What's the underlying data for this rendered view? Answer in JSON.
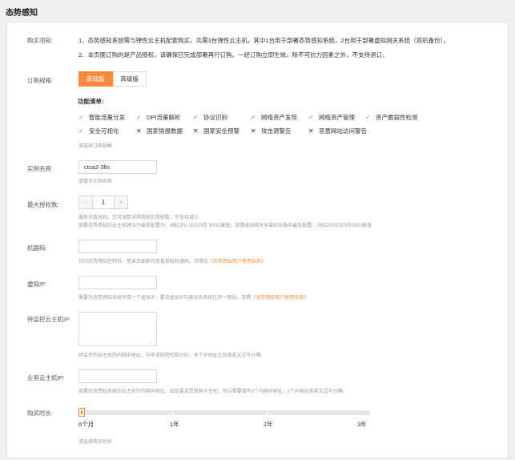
{
  "page": {
    "title": "态势感知"
  },
  "purchase_notice": {
    "label": "购买须知:",
    "lines": [
      "1、态势感知系统需与弹性云主机配套购买，共需3台弹性云主机，其中1台用于部署态势感知系统，2台用于部署虚拟网关系统（双机备份）。",
      "2、本页面订购的是产品授权，请确保已完成部署再行订购。一经订购立即生效，除不可抗力因素之外，不支持退订。"
    ]
  },
  "spec": {
    "label": "订购规格:",
    "tabs": [
      "基础版",
      "高级版"
    ],
    "active_tab": 0,
    "feature_title": "功能清单:",
    "features": [
      {
        "name": "智能流量分发",
        "included": true
      },
      {
        "name": "DPI流量解析",
        "included": true
      },
      {
        "name": "协议识别",
        "included": true
      },
      {
        "name": "网络资产发现",
        "included": true
      },
      {
        "name": "网络资产管理",
        "included": true
      },
      {
        "name": "资产脆弱性检测",
        "included": true
      },
      {
        "name": "安全可视化",
        "included": true
      },
      {
        "name": "国家情报数据",
        "included": false
      },
      {
        "name": "国家安全预警",
        "included": false
      },
      {
        "name": "攻击源警告",
        "included": false
      },
      {
        "name": "恶意网站访问警告",
        "included": false
      }
    ],
    "hint": "请选择订购规格",
    "colors": {
      "accent": "#ff8a3d",
      "check": "#52b152"
    }
  },
  "instance": {
    "label": "实例名称:",
    "value": "ctsa2-3fis",
    "hint": "请填写实例名称"
  },
  "max_auth": {
    "label": "最大授权数:",
    "value": "1",
    "minus": "−",
    "plus": "+",
    "hint1": "服务台数总和。您可调整采购授权的授权数，不支持减小",
    "hint2": "部署态势感知的云主机建议为最低配置为：4核CPU 32G内存 500G硬盘；部署虚拟网关安装的云服务最低配置：2核CPU/2G内存/50G硬盘"
  },
  "machine_code": {
    "label": "机器码:",
    "value": "",
    "hint_prefix": "访问态势感知控制台，登录页面即可查看授权机器码。详情见",
    "hint_link": "《态势感知用户使用指南》"
  },
  "virtual_ip": {
    "label": "虚拟IP:",
    "value": "",
    "hint_prefix": "需要为态势感知系统申请一个虚拟IP，要求虚拟IP与原业务系统在同一网段。参照",
    "hint_link": "《态势感知用户使用指南》"
  },
  "monitored_ip": {
    "label": "待监控云主机IP:",
    "value": "",
    "hint": "待监控的云主机的内网IP地址，与申请的授权数对应。多个IP地址之间用英文逗号分隔。"
  },
  "business_ip": {
    "label": "业务云主机IP:",
    "value": "",
    "hint": "部署态势感知系统的云主机的内网IP地址。如处要求是双网卡主机，所以需要填写2个内网IP地址，2个IP地址用英文逗号分隔。"
  },
  "duration": {
    "label": "购买时长:",
    "ticks": [
      "6个月",
      "1年",
      "2年",
      "3年"
    ],
    "selected_index": 0,
    "hint": "请选择购买时长"
  }
}
